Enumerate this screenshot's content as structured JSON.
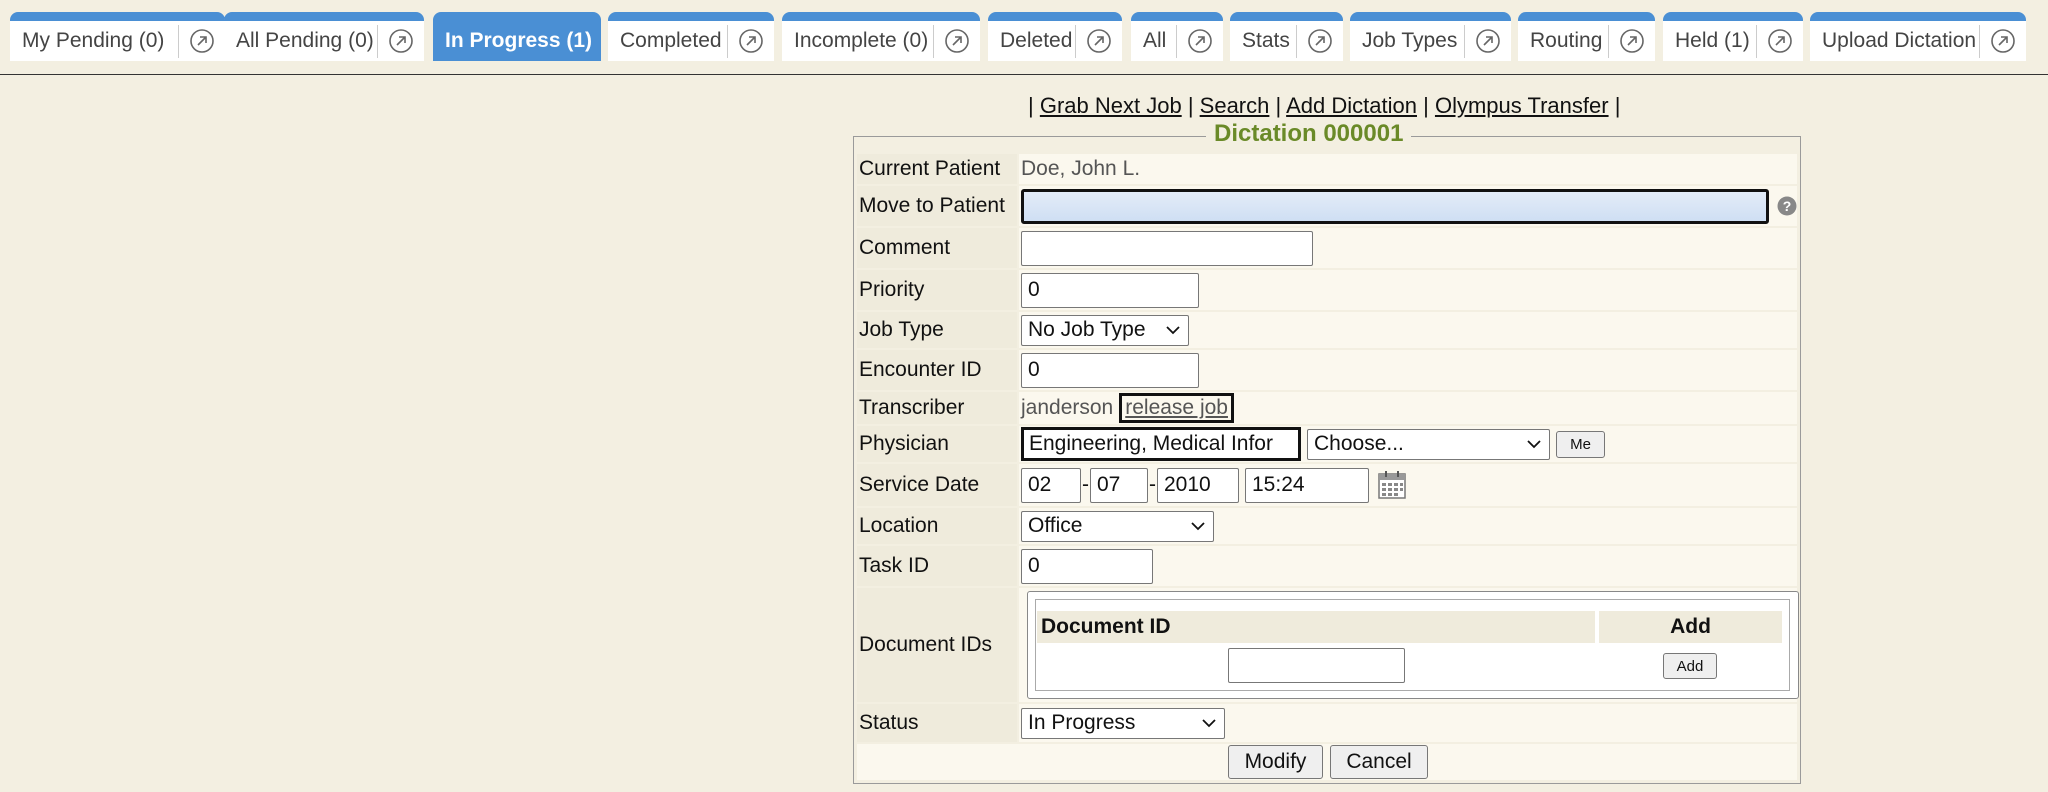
{
  "tabs": [
    {
      "label": "My Pending (0)",
      "active": false
    },
    {
      "label": "All Pending (0)",
      "active": false
    },
    {
      "label": "In Progress (1)",
      "active": true
    },
    {
      "label": "Completed",
      "active": false
    },
    {
      "label": "Incomplete (0)",
      "active": false
    },
    {
      "label": "Deleted",
      "active": false
    },
    {
      "label": "All",
      "active": false
    },
    {
      "label": "Stats",
      "active": false
    },
    {
      "label": "Job Types",
      "active": false
    },
    {
      "label": "Routing",
      "active": false
    },
    {
      "label": "Held (1)",
      "active": false
    },
    {
      "label": "Upload Dictation",
      "active": false
    }
  ],
  "actions": {
    "grab_next_job": "Grab Next Job",
    "search": "Search",
    "add_dictation": "Add Dictation",
    "olympus_transfer": "Olympus Transfer",
    "separator": "|"
  },
  "form": {
    "title": "Dictation 000001",
    "current_patient": {
      "label": "Current Patient",
      "value": "Doe, John L."
    },
    "move_to_patient": {
      "label": "Move to Patient",
      "value": ""
    },
    "comment": {
      "label": "Comment",
      "value": ""
    },
    "priority": {
      "label": "Priority",
      "value": "0"
    },
    "job_type": {
      "label": "Job Type",
      "value": "No Job Type"
    },
    "encounter_id": {
      "label": "Encounter ID",
      "value": "0"
    },
    "transcriber": {
      "label": "Transcriber",
      "value": "janderson",
      "release_link": "release job"
    },
    "physician": {
      "label": "Physician",
      "value": "Engineering, Medical Infor",
      "choose": "Choose...",
      "me_button": "Me"
    },
    "service_date": {
      "label": "Service Date",
      "month": "02",
      "day": "07",
      "year": "2010",
      "time": "15:24",
      "dash": "-"
    },
    "location": {
      "label": "Location",
      "value": "Office"
    },
    "task_id": {
      "label": "Task ID",
      "value": "0"
    },
    "document_ids": {
      "label": "Document IDs",
      "col_document_id": "Document ID",
      "col_add": "Add",
      "add_button": "Add",
      "input_value": ""
    },
    "status": {
      "label": "Status",
      "value": "In Progress"
    },
    "modify_button": "Modify",
    "cancel_button": "Cancel"
  },
  "colors": {
    "tab_accent": "#4a8fd4",
    "legend_title": "#6a8a28",
    "background": "#f3efe1"
  }
}
